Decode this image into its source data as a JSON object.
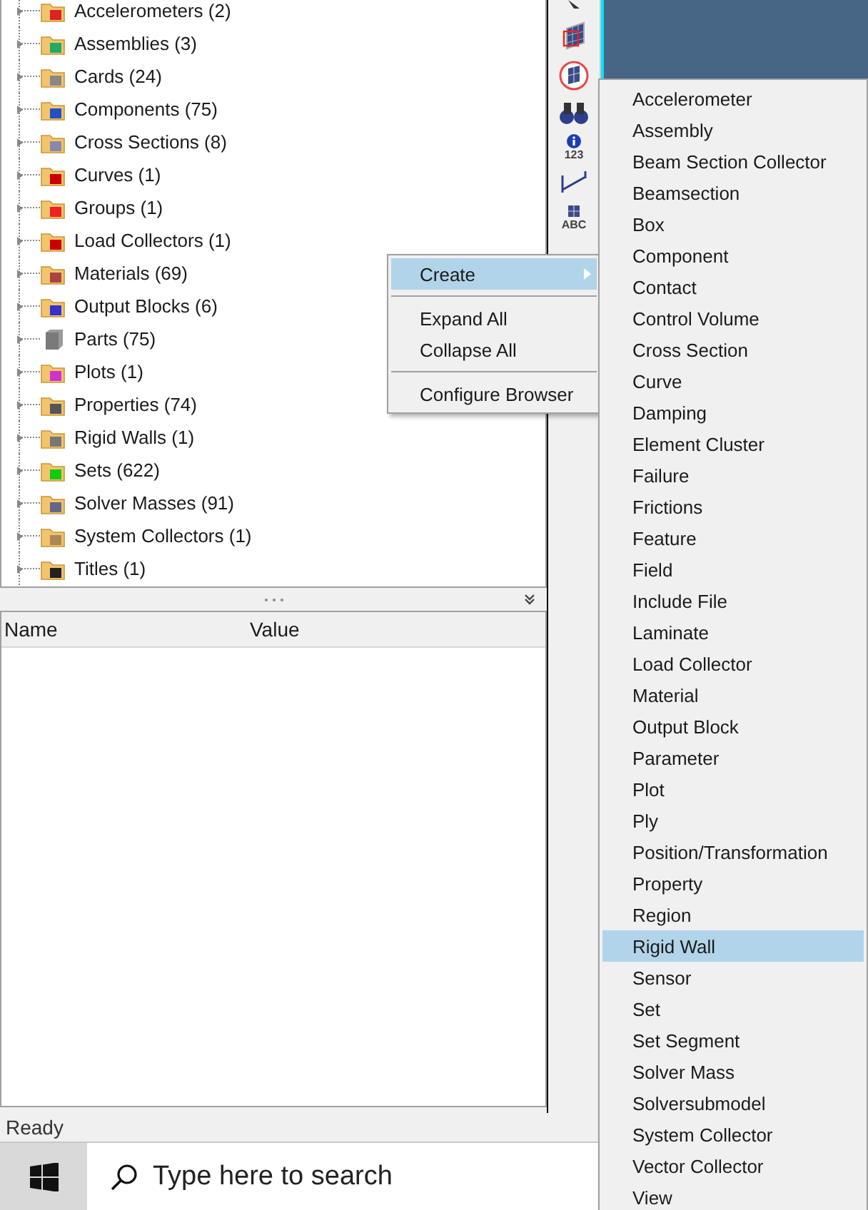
{
  "tree": {
    "items": [
      {
        "label": "Accelerometers (2)",
        "kind": "folder"
      },
      {
        "label": "Assemblies (3)",
        "kind": "folder"
      },
      {
        "label": "Cards (24)",
        "kind": "folder"
      },
      {
        "label": "Components (75)",
        "kind": "folder"
      },
      {
        "label": "Cross Sections (8)",
        "kind": "folder"
      },
      {
        "label": "Curves (1)",
        "kind": "folder"
      },
      {
        "label": "Groups (1)",
        "kind": "folder"
      },
      {
        "label": "Load Collectors (1)",
        "kind": "folder"
      },
      {
        "label": "Materials (69)",
        "kind": "folder"
      },
      {
        "label": "Output Blocks (6)",
        "kind": "folder"
      },
      {
        "label": "Parts (75)",
        "kind": "cube"
      },
      {
        "label": "Plots (1)",
        "kind": "folder"
      },
      {
        "label": "Properties (74)",
        "kind": "folder"
      },
      {
        "label": "Rigid Walls (1)",
        "kind": "folder"
      },
      {
        "label": "Sets (622)",
        "kind": "folder"
      },
      {
        "label": "Solver Masses (91)",
        "kind": "folder"
      },
      {
        "label": "System Collectors (1)",
        "kind": "folder"
      },
      {
        "label": "Titles (1)",
        "kind": "folder"
      }
    ]
  },
  "properties": {
    "columns": [
      "Name",
      "Value"
    ]
  },
  "toolbar": [
    {
      "label": "123"
    },
    {
      "label": "ABC"
    }
  ],
  "context_menu": {
    "groups": [
      [
        {
          "label": "Create",
          "selected": true,
          "submenu": true
        }
      ],
      [
        {
          "label": "Expand All",
          "selected": false,
          "submenu": false
        },
        {
          "label": "Collapse All",
          "selected": false,
          "submenu": false
        }
      ],
      [
        {
          "label": "Configure Browser",
          "selected": false,
          "submenu": false
        }
      ]
    ]
  },
  "submenu": {
    "items": [
      {
        "label": "Accelerometer",
        "selected": false
      },
      {
        "label": "Assembly",
        "selected": false
      },
      {
        "label": "Beam Section Collector",
        "selected": false
      },
      {
        "label": "Beamsection",
        "selected": false
      },
      {
        "label": "Box",
        "selected": false
      },
      {
        "label": "Component",
        "selected": false
      },
      {
        "label": "Contact",
        "selected": false
      },
      {
        "label": "Control Volume",
        "selected": false
      },
      {
        "label": "Cross Section",
        "selected": false
      },
      {
        "label": "Curve",
        "selected": false
      },
      {
        "label": "Damping",
        "selected": false
      },
      {
        "label": "Element Cluster",
        "selected": false
      },
      {
        "label": "Failure",
        "selected": false
      },
      {
        "label": "Frictions",
        "selected": false
      },
      {
        "label": "Feature",
        "selected": false
      },
      {
        "label": "Field",
        "selected": false
      },
      {
        "label": "Include File",
        "selected": false
      },
      {
        "label": "Laminate",
        "selected": false
      },
      {
        "label": "Load Collector",
        "selected": false
      },
      {
        "label": "Material",
        "selected": false
      },
      {
        "label": "Output Block",
        "selected": false
      },
      {
        "label": "Parameter",
        "selected": false
      },
      {
        "label": "Plot",
        "selected": false
      },
      {
        "label": "Ply",
        "selected": false
      },
      {
        "label": "Position/Transformation",
        "selected": false
      },
      {
        "label": "Property",
        "selected": false
      },
      {
        "label": "Region",
        "selected": false
      },
      {
        "label": "Rigid Wall",
        "selected": true
      },
      {
        "label": "Sensor",
        "selected": false
      },
      {
        "label": "Set",
        "selected": false
      },
      {
        "label": "Set Segment",
        "selected": false
      },
      {
        "label": "Solver Mass",
        "selected": false
      },
      {
        "label": "Solversubmodel",
        "selected": false
      },
      {
        "label": "System Collector",
        "selected": false
      },
      {
        "label": "Vector Collector",
        "selected": false
      },
      {
        "label": "View",
        "selected": false
      }
    ]
  },
  "status_bar": {
    "text": "Ready"
  },
  "taskbar": {
    "search": {
      "placeholder": "Type here to search"
    }
  }
}
